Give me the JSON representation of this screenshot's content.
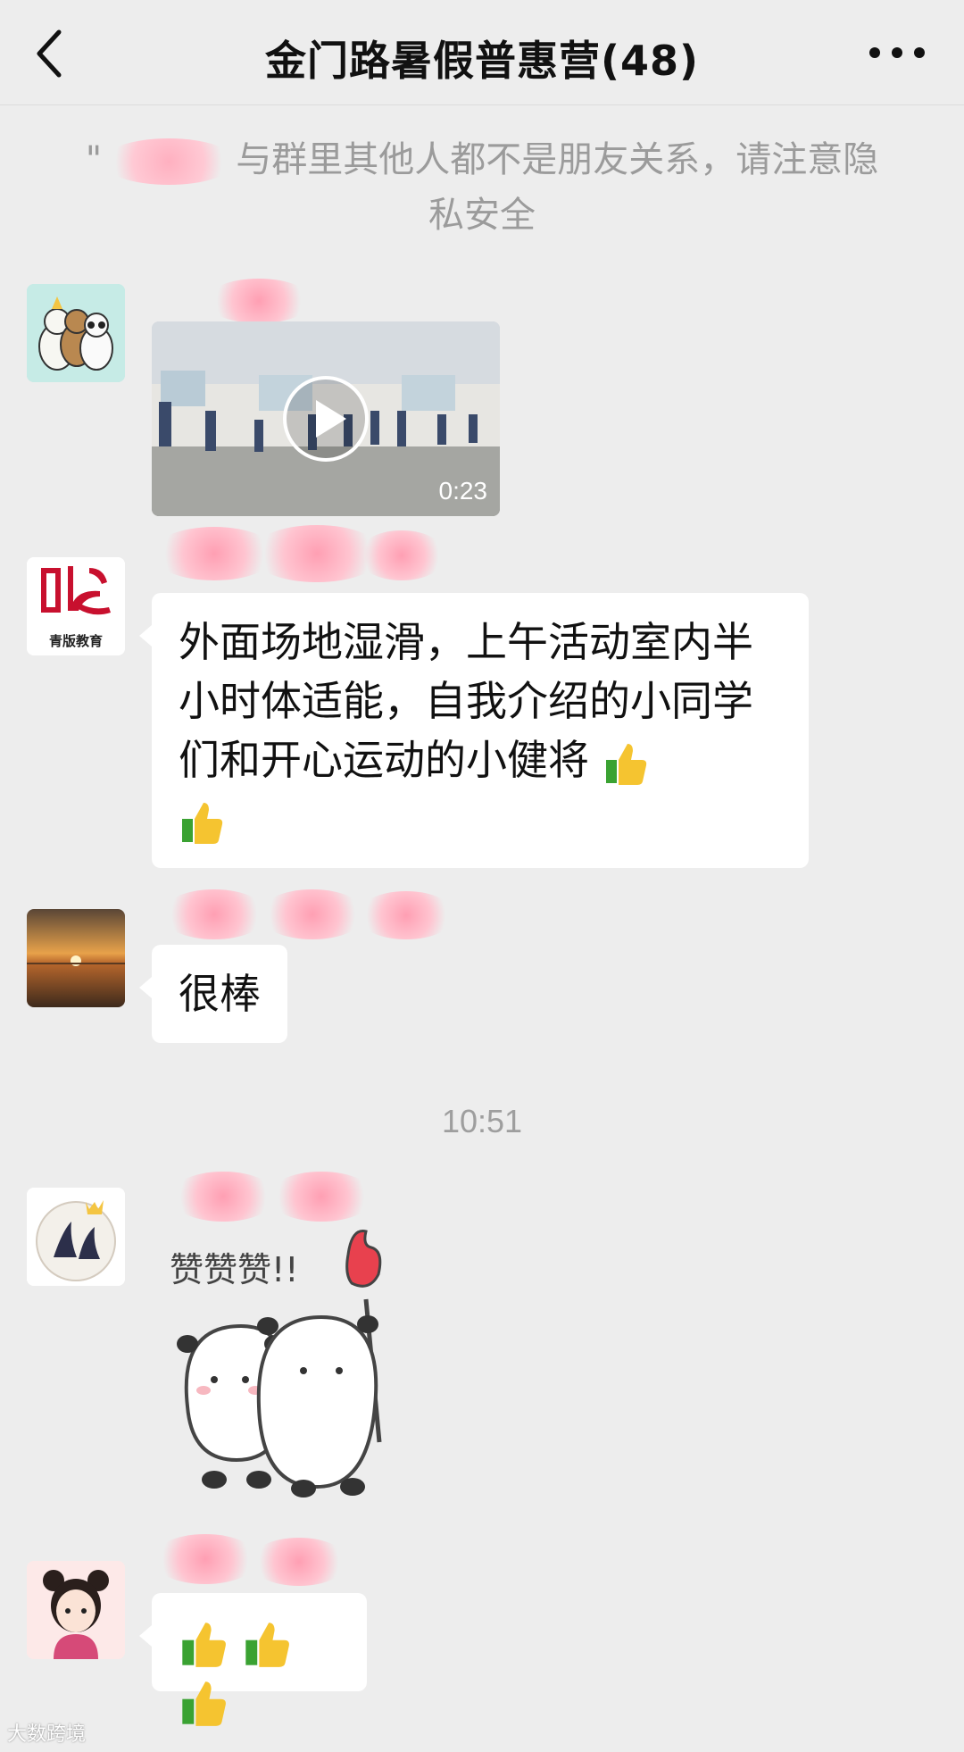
{
  "header": {
    "title": "金门路暑假普惠营",
    "member_count": "(48)",
    "back_icon": "chevron-left-icon",
    "more_icon": "ellipsis-icon"
  },
  "notice": {
    "text_prefix": "\"",
    "text": "与群里其他人都不是朋友关系，请注意隐私安全"
  },
  "messages": [
    {
      "type": "video",
      "duration": "0:23",
      "avatar": "cartoon-bears"
    },
    {
      "type": "text",
      "text": "外面场地湿滑，上午活动室内半小时体适能，自我介绍的小同学们和开心运动的小健将",
      "avatar": "qingban-logo",
      "avatar_caption": "青版教育"
    },
    {
      "type": "text",
      "text": "很棒",
      "avatar": "sunset"
    },
    {
      "type": "sticker",
      "sticker_text": "赞赞赞!!",
      "avatar": "dolphin-crown"
    },
    {
      "type": "emoji",
      "avatar": "cartoon-girl"
    }
  ],
  "timestamp": "10:51",
  "watermark": "大数跨境",
  "colors": {
    "background": "#ededed",
    "bubble": "#ffffff",
    "blur": "#ffb0c0"
  }
}
